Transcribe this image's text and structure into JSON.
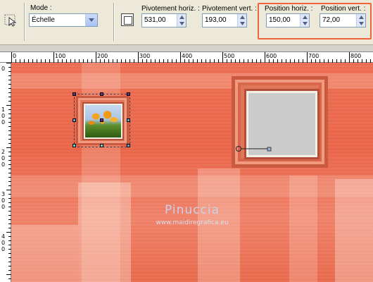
{
  "toolbar": {
    "mode_label": "Mode :",
    "mode_value": "Échelle",
    "pivot_h_label": "Pivotement horiz. :",
    "pivot_h_value": "531,00",
    "pivot_v_label": "Pivotement vert. :",
    "pivot_v_value": "193,00",
    "pos_h_label": "Position horiz. :",
    "pos_h_value": "150,00",
    "pos_v_label": "Position vert. :",
    "pos_v_value": "72,00",
    "highlight_color": "#f0643b"
  },
  "ruler_top": {
    "labels": [
      "0",
      "100",
      "200",
      "300",
      "400",
      "500",
      "600",
      "700",
      "800"
    ]
  },
  "ruler_left": {
    "labels": [
      "0",
      "1",
      "0",
      "0",
      "2",
      "0",
      "0",
      "3",
      "0",
      "0",
      "4",
      "0",
      "0"
    ]
  },
  "canvas": {
    "watermark_title": "Pinuccia",
    "watermark_url": "www.maidiregrafica.eu",
    "background_color": "#e9654a"
  }
}
